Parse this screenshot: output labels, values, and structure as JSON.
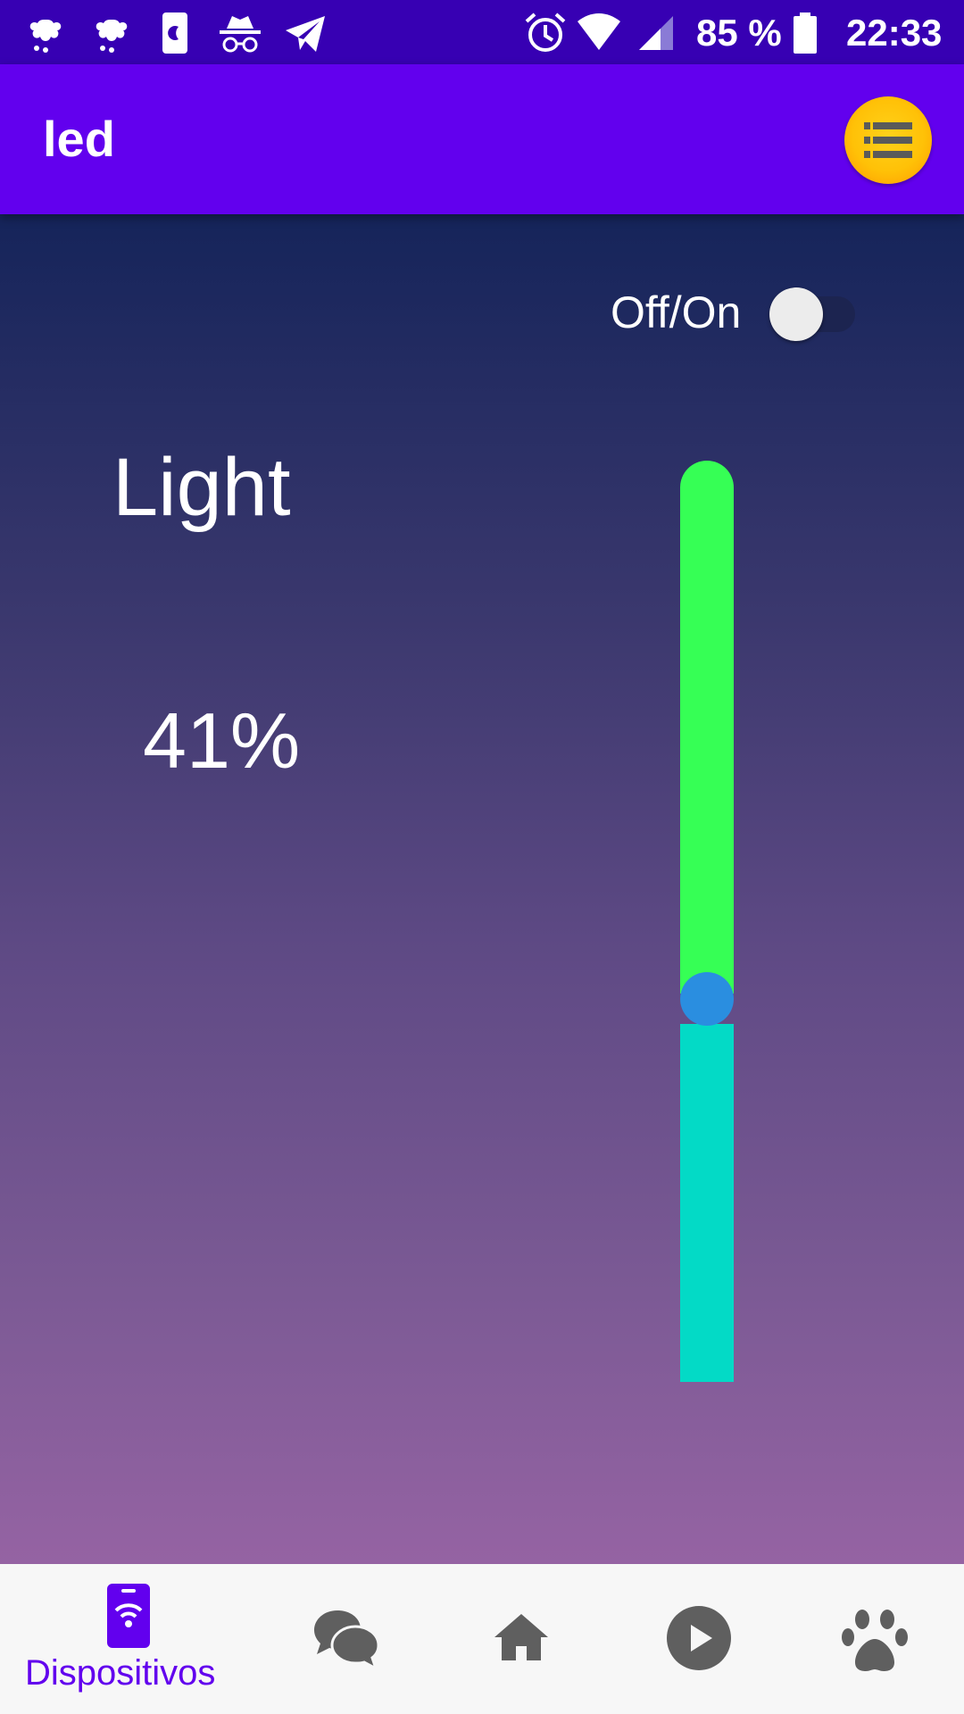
{
  "status_bar": {
    "battery_text": "85 %",
    "time": "22:33",
    "icons": [
      "bug-icon",
      "bug-icon",
      "phone-night-icon",
      "incognito-icon",
      "telegram-icon",
      "alarm-icon",
      "wifi-icon",
      "signal-icon",
      "battery-icon"
    ]
  },
  "app_bar": {
    "title": "led",
    "menu_icon": "list-icon"
  },
  "content": {
    "toggle": {
      "label": "Off/On",
      "on": false
    },
    "light_label": "Light",
    "percent": "41%",
    "slider": {
      "value": 0.41
    }
  },
  "bottom_nav": {
    "items": [
      {
        "label": "Dispositivos",
        "icon": "phone-wifi-icon",
        "selected": true
      },
      {
        "icon": "chat-icon",
        "selected": false
      },
      {
        "icon": "home-icon",
        "selected": false
      },
      {
        "icon": "play-icon",
        "selected": false
      },
      {
        "icon": "paw-icon",
        "selected": false
      }
    ]
  },
  "colors": {
    "status_bar": "#3700b3",
    "app_bar": "#6200ee",
    "slider_upper": "#36ff55",
    "slider_lower": "#03dac6",
    "slider_thumb": "#2a8ee0",
    "nav_selected": "#6200ee",
    "nav_unselected": "#5f5f5f"
  }
}
